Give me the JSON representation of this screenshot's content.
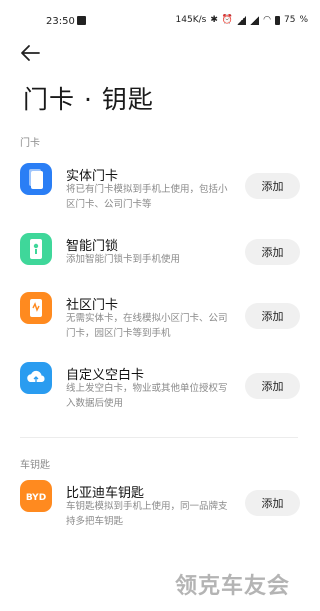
{
  "status_bar": {
    "time": "23:50",
    "network_speed": "145K/s",
    "battery": "75"
  },
  "header": {
    "title": "门卡 · 钥匙"
  },
  "sections": {
    "door_cards_label": "门卡",
    "car_keys_label": "车钥匙"
  },
  "door_cards": [
    {
      "title": "实体门卡",
      "desc": "将已有门卡模拟到手机上使用，包括小区门卡、公司门卡等",
      "button": "添加",
      "icon": "card-icon",
      "color": "#2a7ef5"
    },
    {
      "title": "智能门锁",
      "desc": "添加智能门锁卡到手机使用",
      "button": "添加",
      "icon": "smart-lock-icon",
      "color": "#3fd79a"
    },
    {
      "title": "社区门卡",
      "desc": "无需实体卡，在线模拟小区门卡、公司门卡，园区门卡等到手机",
      "button": "添加",
      "icon": "community-card-icon",
      "color": "#ff8a1f"
    },
    {
      "title": "自定义空白卡",
      "desc": "线上发空白卡，物业或其他单位授权写入数据后使用",
      "button": "添加",
      "icon": "cloud-card-icon",
      "color": "#2a9cf0"
    }
  ],
  "car_keys": [
    {
      "title": "比亚迪车钥匙",
      "desc": "车钥匙模拟到手机上使用，同一品牌支持多把车钥匙",
      "button": "添加",
      "icon": "byd-logo-icon",
      "logo_text": "BYD",
      "color": "#ff8a1f"
    }
  ],
  "watermark": "领克车友会"
}
